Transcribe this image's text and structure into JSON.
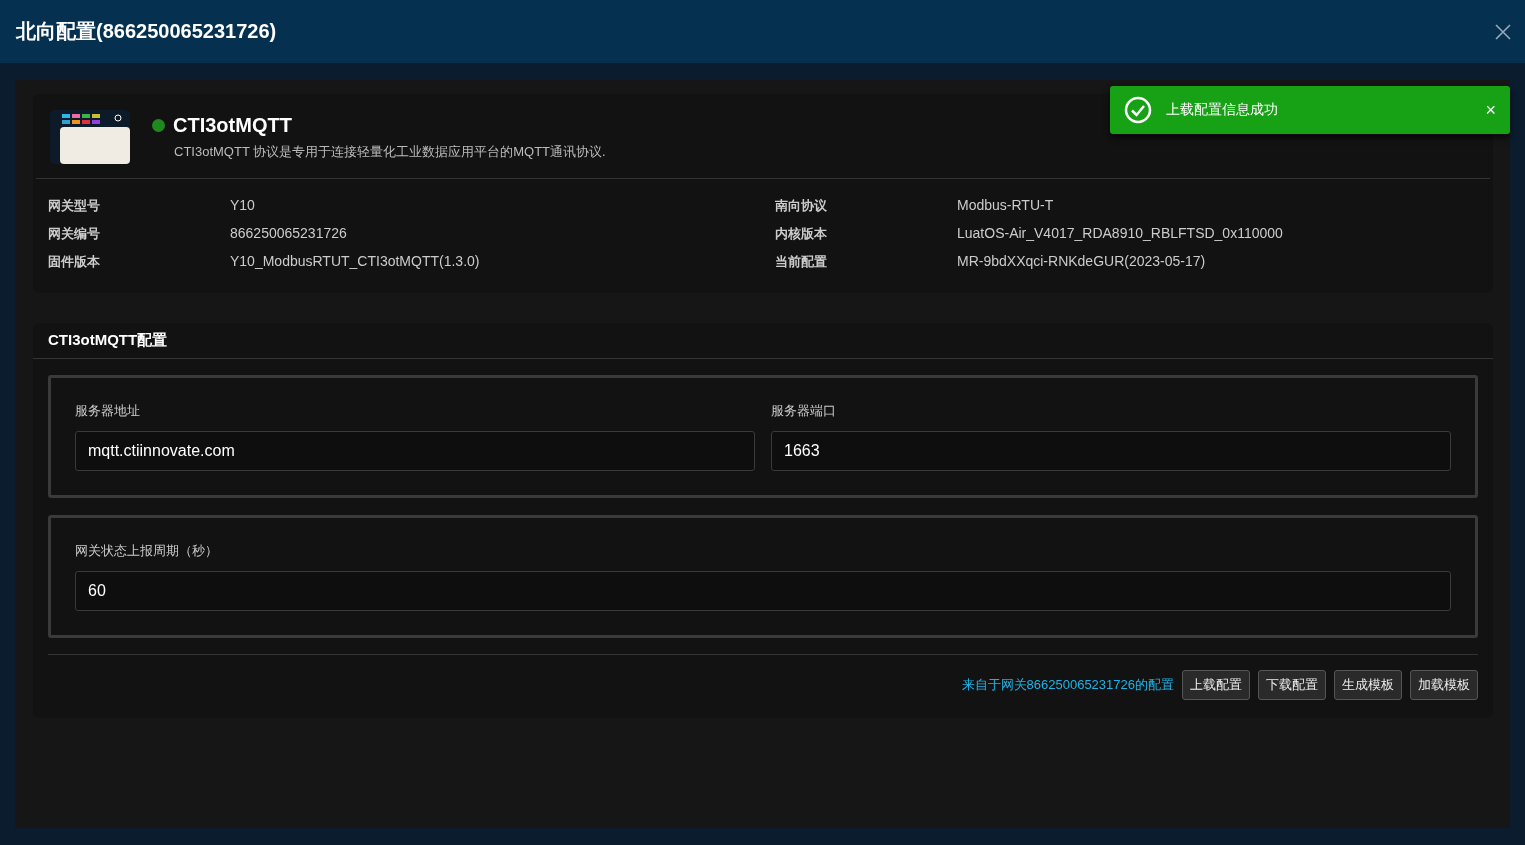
{
  "window": {
    "title": "北向配置(866250065231726)"
  },
  "toast": {
    "kind": "success",
    "message": "上载配置信息成功",
    "close": "×"
  },
  "protocol": {
    "name": "CTI3otMQTT",
    "color": "#1e8a1e",
    "description": "CTI3otMQTT 协议是专用于连接轻量化工业数据应用平台的MQTT通讯协议."
  },
  "info": [
    {
      "label": "网关型号",
      "value": "Y10"
    },
    {
      "label": "南向协议",
      "value": "Modbus-RTU-T"
    },
    {
      "label": "网关编号",
      "value": "866250065231726"
    },
    {
      "label": "内核版本",
      "value": "LuatOS-Air_V4017_RDA8910_RBLFTSD_0x110000"
    },
    {
      "label": "固件版本",
      "value": "Y10_ModbusRTUT_CTI3otMQTT(1.3.0)"
    },
    {
      "label": "当前配置",
      "value": "MR-9bdXXqci-RNKdeGUR(2023-05-17)"
    }
  ],
  "config": {
    "title": "CTI3otMQTT配置",
    "groups": [
      {
        "fields": [
          {
            "label": "服务器地址",
            "value": "mqtt.ctiinnovate.com"
          },
          {
            "label": "服务器端口",
            "value": "1663"
          }
        ]
      },
      {
        "fields": [
          {
            "label": "网关状态上报周期（秒）",
            "value": "60"
          }
        ]
      }
    ],
    "source_link": "来自于网关866250065231726的配置",
    "buttons": [
      "上载配置",
      "下载配置",
      "生成模板",
      "加载模板"
    ]
  }
}
